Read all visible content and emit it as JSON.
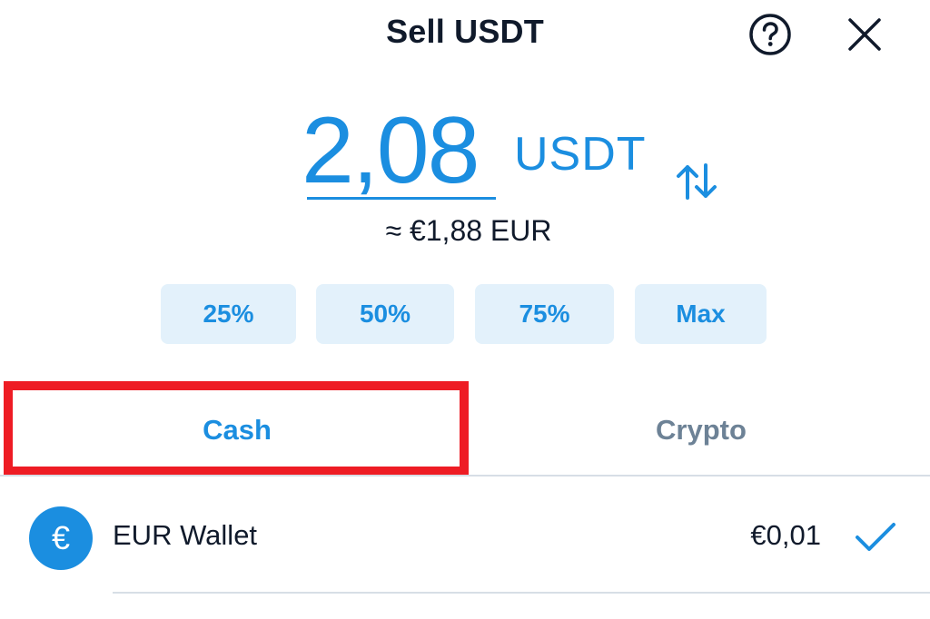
{
  "header": {
    "title": "Sell USDT",
    "help_icon": "question-circle-icon",
    "close_icon": "close-icon"
  },
  "amount": {
    "value": "2,08",
    "currency": "USDT",
    "converted": "≈ €1,88 EUR",
    "swap_icon": "swap-arrows-icon"
  },
  "quick_amounts": [
    "25%",
    "50%",
    "75%",
    "Max"
  ],
  "tabs": [
    {
      "label": "Cash",
      "active": true
    },
    {
      "label": "Crypto",
      "active": false
    }
  ],
  "wallet": {
    "icon_symbol": "€",
    "name": "EUR Wallet",
    "balance": "€0,01",
    "selected": true,
    "check_icon": "checkmark-icon"
  },
  "colors": {
    "accent": "#1b8ee0",
    "accent_light": "#e3f1fb",
    "text": "#101a2b",
    "muted": "#6d8296",
    "highlight": "#ee1c24"
  }
}
